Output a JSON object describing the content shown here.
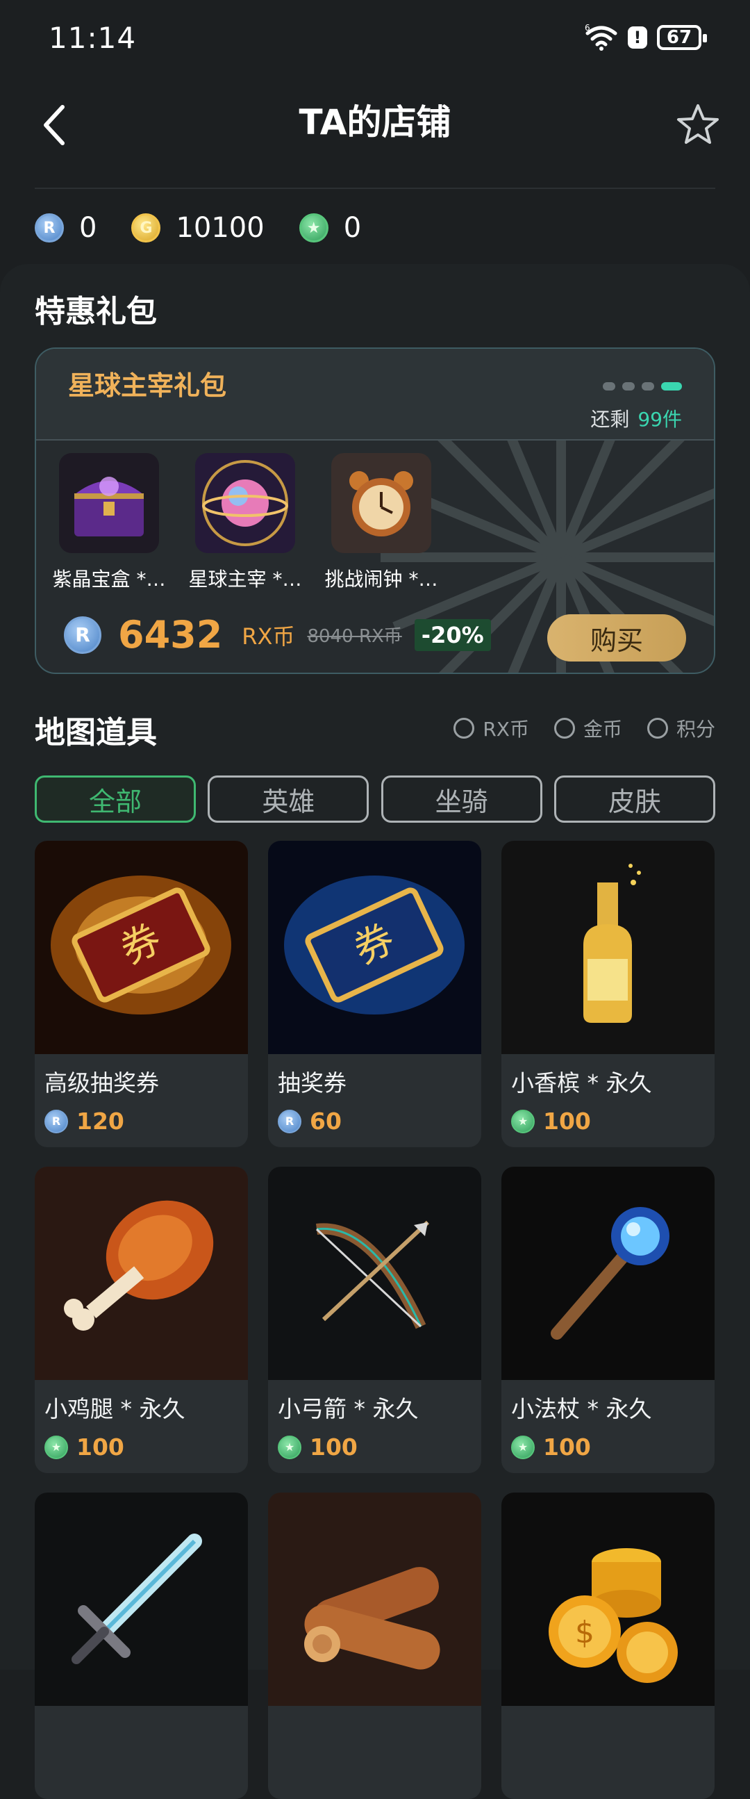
{
  "status": {
    "time": "11:14",
    "battery": "67",
    "signal_tag": "6"
  },
  "header": {
    "title": "TA的店铺"
  },
  "balances": {
    "rx": "0",
    "gold": "10100",
    "points": "0"
  },
  "gift_section": {
    "title": "特惠礼包",
    "pack": {
      "name": "星球主宰礼包",
      "remaining_label": "还剩",
      "remaining_value": "99件",
      "items": [
        {
          "label": "紫晶宝盒 *…"
        },
        {
          "label": "星球主宰 *…"
        },
        {
          "label": "挑战闹钟 *…"
        }
      ],
      "price": "6432",
      "unit": "RX币",
      "original_price": "8040 RX币",
      "discount": "-20%",
      "buy_label": "购买"
    }
  },
  "map_section": {
    "title": "地图道具",
    "filters": [
      "RX币",
      "金币",
      "积分"
    ],
    "tabs": [
      "全部",
      "英雄",
      "坐骑",
      "皮肤"
    ]
  },
  "products": [
    {
      "name": "高级抽奖券",
      "price": "120",
      "currency": "rx"
    },
    {
      "name": "抽奖券",
      "price": "60",
      "currency": "rx"
    },
    {
      "name": "小香槟 * 永久",
      "price": "100",
      "currency": "points"
    },
    {
      "name": "小鸡腿 * 永久",
      "price": "100",
      "currency": "points"
    },
    {
      "name": "小弓箭 * 永久",
      "price": "100",
      "currency": "points"
    },
    {
      "name": "小法杖 * 永久",
      "price": "100",
      "currency": "points"
    },
    {
      "name": "",
      "price": "",
      "currency": ""
    },
    {
      "name": "",
      "price": "",
      "currency": ""
    },
    {
      "name": "",
      "price": "",
      "currency": ""
    }
  ],
  "colors": {
    "accent_green": "#3fb871",
    "price_orange": "#f0a645",
    "teal": "#3ad6b0"
  }
}
